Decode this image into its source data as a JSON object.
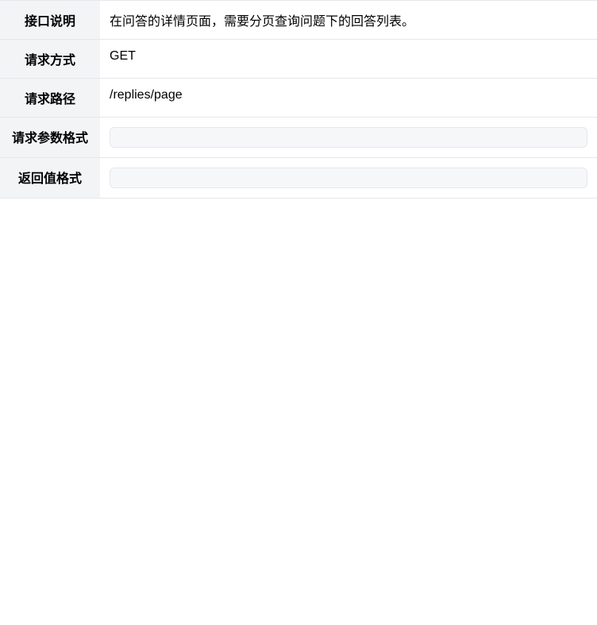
{
  "rows": [
    {
      "label": "接口说明",
      "value": "在问答的详情页面，需要分页查询问题下的回答列表。"
    },
    {
      "label": "请求方式",
      "value": "GET"
    },
    {
      "label": "请求路径",
      "value": "/replies/page"
    }
  ],
  "request_params_label": "请求参数格式",
  "response_label": "返回值格式"
}
